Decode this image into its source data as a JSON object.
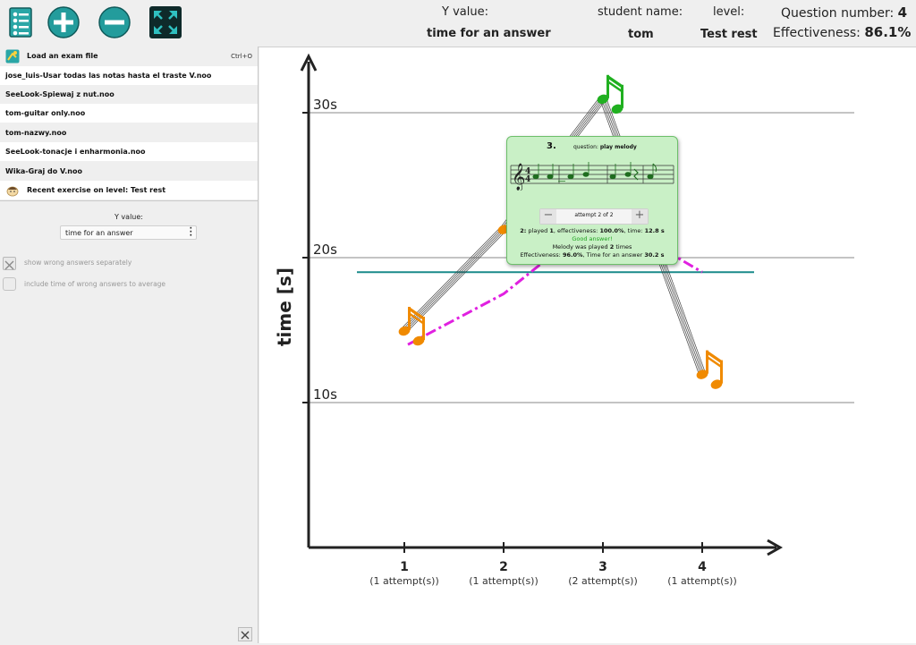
{
  "toolbar": {
    "buttons": [
      {
        "name": "exam-list-icon"
      },
      {
        "name": "zoom-in-icon"
      },
      {
        "name": "zoom-out-icon"
      },
      {
        "name": "fullscreen-icon"
      }
    ]
  },
  "header": {
    "y_value_label": "Y value:",
    "y_value": "time for an answer",
    "student_label": "student name:",
    "student": "tom",
    "level_label": "level:",
    "level": "Test rest",
    "question_label": "Question number:",
    "question_number": "4",
    "effectiveness_label": "Effectiveness:",
    "effectiveness": "86.1%"
  },
  "menu": {
    "load_label": "Load an exam file",
    "load_shortcut": "Ctrl+O",
    "files": [
      "jose_luis-Usar todas las notas hasta el traste V.noo",
      "SeeLook-Spiewaj z nut.noo",
      "tom-guitar only.noo",
      "tom-nazwy.noo",
      "SeeLook-tonacje i enharmonia.noo",
      "Wika-Graj do V.noo"
    ],
    "recent_label": "Recent exercise on level: Test rest"
  },
  "settings": {
    "y_value_label": "Y value:",
    "y_value_selected": "time for an answer",
    "wrong_separately_label": "show wrong answers separately",
    "wrong_to_average_label": "include time of wrong answers to average"
  },
  "colors": {
    "correct_note": "#20b020",
    "attempt_note": "#f08a00",
    "trend_line": "#e020e0",
    "average_line": "#1a8a8a",
    "tooltip_bg": "#c9f0c6"
  },
  "chart_data": {
    "type": "line",
    "ylabel": "time [s]",
    "y_ticks": [
      "10s",
      "20s",
      "30s"
    ],
    "ylim": [
      0,
      34
    ],
    "x": [
      1,
      2,
      3,
      4
    ],
    "x_sublabels": [
      "(1 attempt(s))",
      "(1 attempt(s))",
      "(2 attempt(s))",
      "(1 attempt(s))"
    ],
    "series": [
      {
        "values": [
          15.0,
          22.0,
          31.0,
          12.0
        ]
      }
    ],
    "trend": [
      14.0,
      17.5,
      23.0,
      19.0
    ],
    "average": 19.0
  },
  "tooltip": {
    "question_number": "3.",
    "question_prefix": "question:",
    "question_text": "play melody",
    "attempt_text": "attempt 2 of 2",
    "line1_prefix": "2:",
    "line1_played": "played",
    "line1_played_val": "1",
    "line1_eff": ", effectiveness:",
    "line1_eff_val": "100.0%",
    "line1_time": ", time:",
    "line1_time_val": "12.8 s",
    "good": "Good answer!",
    "melody_prefix": "Melody was played",
    "melody_times": "2",
    "melody_suffix": "times",
    "eff_label": "Effectiveness:",
    "eff_val": "96.0%",
    "time_label": ", Time for an answer",
    "time_val": "30.2 s"
  }
}
